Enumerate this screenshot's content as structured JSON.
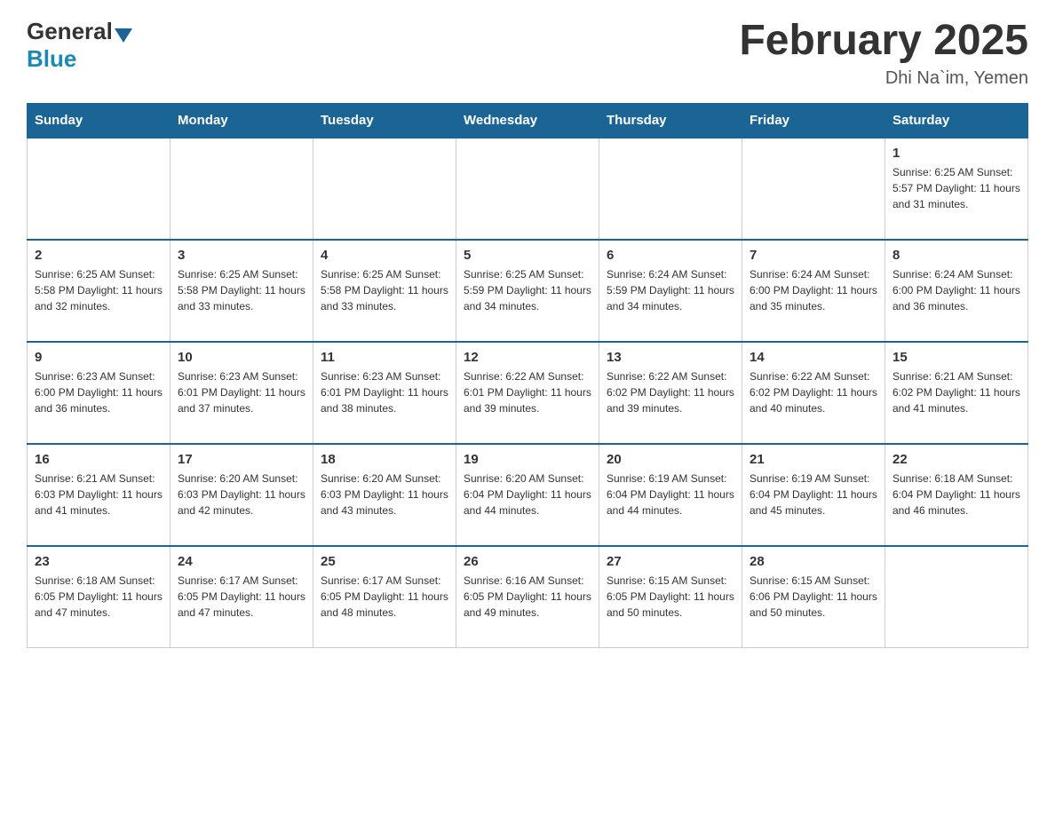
{
  "header": {
    "logo": {
      "general": "General",
      "blue": "Blue"
    },
    "title": "February 2025",
    "location": "Dhi Na`im, Yemen"
  },
  "days_of_week": [
    "Sunday",
    "Monday",
    "Tuesday",
    "Wednesday",
    "Thursday",
    "Friday",
    "Saturday"
  ],
  "weeks": [
    [
      {
        "day": "",
        "info": ""
      },
      {
        "day": "",
        "info": ""
      },
      {
        "day": "",
        "info": ""
      },
      {
        "day": "",
        "info": ""
      },
      {
        "day": "",
        "info": ""
      },
      {
        "day": "",
        "info": ""
      },
      {
        "day": "1",
        "info": "Sunrise: 6:25 AM\nSunset: 5:57 PM\nDaylight: 11 hours and 31 minutes."
      }
    ],
    [
      {
        "day": "2",
        "info": "Sunrise: 6:25 AM\nSunset: 5:58 PM\nDaylight: 11 hours and 32 minutes."
      },
      {
        "day": "3",
        "info": "Sunrise: 6:25 AM\nSunset: 5:58 PM\nDaylight: 11 hours and 33 minutes."
      },
      {
        "day": "4",
        "info": "Sunrise: 6:25 AM\nSunset: 5:58 PM\nDaylight: 11 hours and 33 minutes."
      },
      {
        "day": "5",
        "info": "Sunrise: 6:25 AM\nSunset: 5:59 PM\nDaylight: 11 hours and 34 minutes."
      },
      {
        "day": "6",
        "info": "Sunrise: 6:24 AM\nSunset: 5:59 PM\nDaylight: 11 hours and 34 minutes."
      },
      {
        "day": "7",
        "info": "Sunrise: 6:24 AM\nSunset: 6:00 PM\nDaylight: 11 hours and 35 minutes."
      },
      {
        "day": "8",
        "info": "Sunrise: 6:24 AM\nSunset: 6:00 PM\nDaylight: 11 hours and 36 minutes."
      }
    ],
    [
      {
        "day": "9",
        "info": "Sunrise: 6:23 AM\nSunset: 6:00 PM\nDaylight: 11 hours and 36 minutes."
      },
      {
        "day": "10",
        "info": "Sunrise: 6:23 AM\nSunset: 6:01 PM\nDaylight: 11 hours and 37 minutes."
      },
      {
        "day": "11",
        "info": "Sunrise: 6:23 AM\nSunset: 6:01 PM\nDaylight: 11 hours and 38 minutes."
      },
      {
        "day": "12",
        "info": "Sunrise: 6:22 AM\nSunset: 6:01 PM\nDaylight: 11 hours and 39 minutes."
      },
      {
        "day": "13",
        "info": "Sunrise: 6:22 AM\nSunset: 6:02 PM\nDaylight: 11 hours and 39 minutes."
      },
      {
        "day": "14",
        "info": "Sunrise: 6:22 AM\nSunset: 6:02 PM\nDaylight: 11 hours and 40 minutes."
      },
      {
        "day": "15",
        "info": "Sunrise: 6:21 AM\nSunset: 6:02 PM\nDaylight: 11 hours and 41 minutes."
      }
    ],
    [
      {
        "day": "16",
        "info": "Sunrise: 6:21 AM\nSunset: 6:03 PM\nDaylight: 11 hours and 41 minutes."
      },
      {
        "day": "17",
        "info": "Sunrise: 6:20 AM\nSunset: 6:03 PM\nDaylight: 11 hours and 42 minutes."
      },
      {
        "day": "18",
        "info": "Sunrise: 6:20 AM\nSunset: 6:03 PM\nDaylight: 11 hours and 43 minutes."
      },
      {
        "day": "19",
        "info": "Sunrise: 6:20 AM\nSunset: 6:04 PM\nDaylight: 11 hours and 44 minutes."
      },
      {
        "day": "20",
        "info": "Sunrise: 6:19 AM\nSunset: 6:04 PM\nDaylight: 11 hours and 44 minutes."
      },
      {
        "day": "21",
        "info": "Sunrise: 6:19 AM\nSunset: 6:04 PM\nDaylight: 11 hours and 45 minutes."
      },
      {
        "day": "22",
        "info": "Sunrise: 6:18 AM\nSunset: 6:04 PM\nDaylight: 11 hours and 46 minutes."
      }
    ],
    [
      {
        "day": "23",
        "info": "Sunrise: 6:18 AM\nSunset: 6:05 PM\nDaylight: 11 hours and 47 minutes."
      },
      {
        "day": "24",
        "info": "Sunrise: 6:17 AM\nSunset: 6:05 PM\nDaylight: 11 hours and 47 minutes."
      },
      {
        "day": "25",
        "info": "Sunrise: 6:17 AM\nSunset: 6:05 PM\nDaylight: 11 hours and 48 minutes."
      },
      {
        "day": "26",
        "info": "Sunrise: 6:16 AM\nSunset: 6:05 PM\nDaylight: 11 hours and 49 minutes."
      },
      {
        "day": "27",
        "info": "Sunrise: 6:15 AM\nSunset: 6:05 PM\nDaylight: 11 hours and 50 minutes."
      },
      {
        "day": "28",
        "info": "Sunrise: 6:15 AM\nSunset: 6:06 PM\nDaylight: 11 hours and 50 minutes."
      },
      {
        "day": "",
        "info": ""
      }
    ]
  ]
}
